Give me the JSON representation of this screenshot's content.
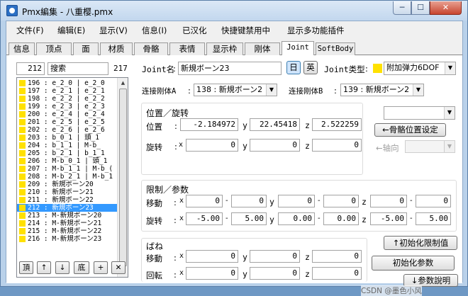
{
  "window": {
    "title": "Pmx編集 - 八重樱.pmx",
    "min": "─",
    "max": "☐",
    "close": "✕"
  },
  "menu": [
    "文件(F)",
    "编辑(E)",
    "显示(V)",
    "信息(I)",
    "已汉化",
    "快捷键禁用中",
    "显示多功能插件"
  ],
  "tabs": [
    "信息",
    "顶点",
    "面",
    "材质",
    "骨骼",
    "表情",
    "显示枠",
    "刚体",
    "Joint",
    "SoftBody"
  ],
  "active_tab": "Joint",
  "list": {
    "index": "212",
    "search": "搜索",
    "count": "217",
    "rows": [
      "196 : e_2_0  | e_2_0",
      "197 : e_2_1  | e_2_1",
      "198 : e_2_2  | e_2_2",
      "199 : e_2_3  | e_2_3",
      "200 : e_2_4  | e_2_4",
      "201 : e_2_5  | e_2_5",
      "202 : e_2_6  | e_2_6",
      "203 : b_0_1  | 頭_1",
      "204 : b_1_1  | M-b_",
      "205 : b_2_1  | b_1_1",
      "206 : M-b_0_1  | 頭_1",
      "207 : M-b_1_1  | M-b_(",
      "208 : M-b_2_1  | M-b_1",
      "209 : 新規ボーン20",
      "210 : 新規ボーン21",
      "211 : 新規ボーン22",
      "212 : 新規ボーン23",
      "213 : M-新規ボーン20",
      "214 : M-新規ボーン21",
      "215 : M-新規ボーン22",
      "216 : M-新規ボーン23"
    ],
    "selected_row": 16,
    "buttons": [
      "頂",
      "↑",
      "↓",
      "底",
      "+",
      "✕"
    ]
  },
  "joint": {
    "name_label": "Joint名",
    "name_value": "新規ボーン23",
    "lang_jp": "日",
    "lang_en": "英",
    "type_label": "Joint类型",
    "type_value": "附加弹力6DOF",
    "body_a_label": "连接刚体A",
    "body_a_value": "138 : 新規ボーン2",
    "body_b_label": "连接刚体B",
    "body_b_value": "139 : 新規ボーン2",
    "pos_group_title": "位置／旋转",
    "pos_label": "位置",
    "rot_label": "旋转",
    "position": [
      "-2.184972",
      "22.45418",
      "2.522259"
    ],
    "rotation": [
      "0",
      "0",
      "0"
    ],
    "bone_combo": "",
    "bone_pos_button": "←骨骼位置设定",
    "axis_label": "←轴向",
    "axis_combo": "",
    "limit_group_title": "限制／参数",
    "move_label": "移動",
    "rot_label2": "旋转",
    "move_limits": [
      "0",
      "0",
      "0",
      "0",
      "0",
      "0"
    ],
    "rot_limits": [
      "-5.00",
      "5.00",
      "0.00",
      "0.00",
      "-5.00",
      "5.00"
    ],
    "spring_title": "ばね",
    "spring_move_label": "移動",
    "spring_rot_label": "回転",
    "spring_move": [
      "0",
      "0",
      "0"
    ],
    "spring_rot": [
      "0",
      "0",
      "0"
    ],
    "init_limit_button": "↑初始化限制值",
    "init_param_button": "初始化参数",
    "param_desc_button": "↓参数說明",
    "colon": ":",
    "dash": "-",
    "x": "x",
    "y": "y",
    "z": "z",
    "watermark": "CSDN @墨色小风"
  }
}
